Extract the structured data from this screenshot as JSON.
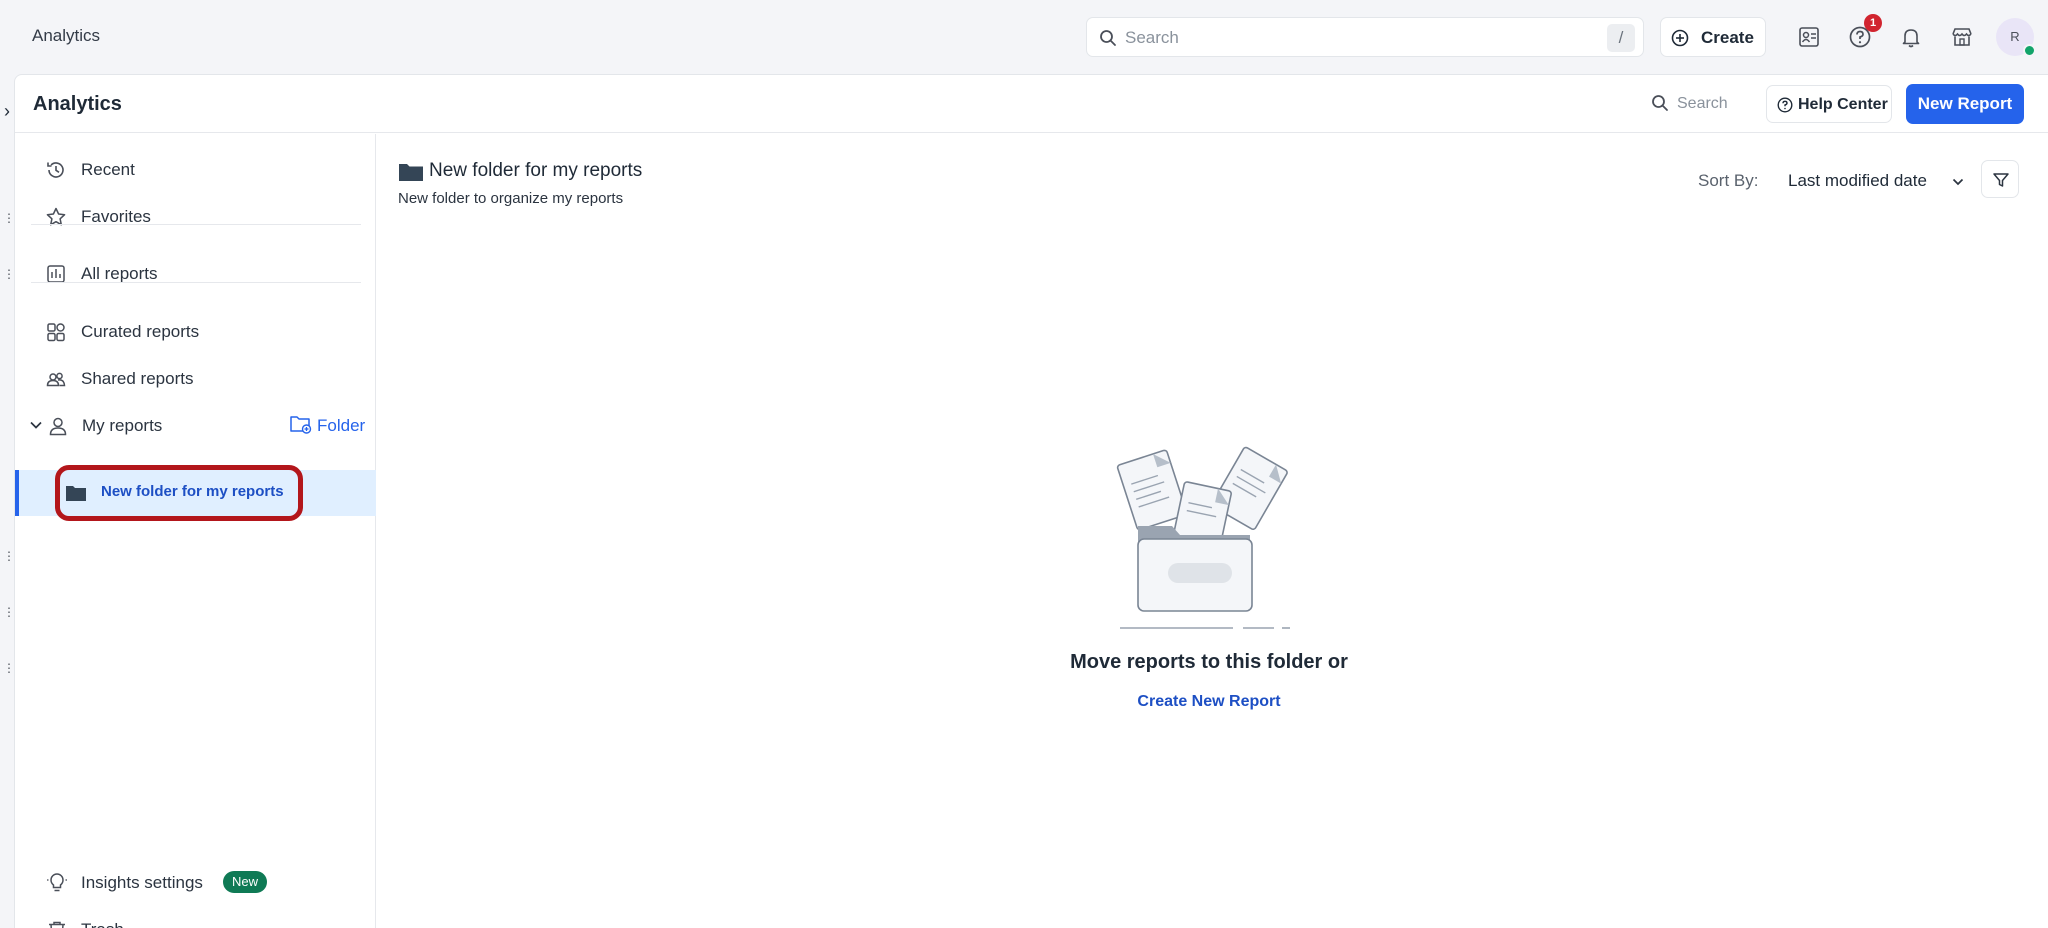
{
  "topbar": {
    "app_name": "Analytics",
    "search_placeholder": "Search",
    "search_shortcut": "/",
    "create_label": "Create",
    "notification_count": "1",
    "avatar_initial": "R",
    "icons": [
      "contacts-icon",
      "help-icon",
      "bell-icon",
      "store-icon"
    ]
  },
  "header": {
    "title": "Analytics",
    "search_label": "Search",
    "help_label": "Help Center",
    "new_report_label": "New Report"
  },
  "sidebar": {
    "items": [
      {
        "label": "Recent",
        "icon": "history-icon"
      },
      {
        "label": "Favorites",
        "icon": "star-icon"
      },
      {
        "label": "All reports",
        "icon": "reports-icon"
      },
      {
        "label": "Curated reports",
        "icon": "grid-icon"
      },
      {
        "label": "Shared reports",
        "icon": "users-icon"
      },
      {
        "label": "My reports",
        "icon": "user-icon"
      }
    ],
    "folder_add_label": "Folder",
    "active_folder": "New folder for my reports",
    "bottom_items": [
      {
        "label": "Insights settings",
        "icon": "lightbulb-icon",
        "badge": "New"
      },
      {
        "label": "Trash",
        "icon": "trash-icon"
      }
    ]
  },
  "content": {
    "folder_title": "New folder for my reports",
    "folder_description": "New folder to organize my reports",
    "sort_label": "Sort By:",
    "sort_value": "Last modified date",
    "empty_title": "Move reports to this folder or",
    "empty_link": "Create New Report"
  },
  "colors": {
    "accent": "#2563eb",
    "active_bg": "#e0efff",
    "highlight": "#b3161b",
    "badge_green": "#0f7a55"
  }
}
